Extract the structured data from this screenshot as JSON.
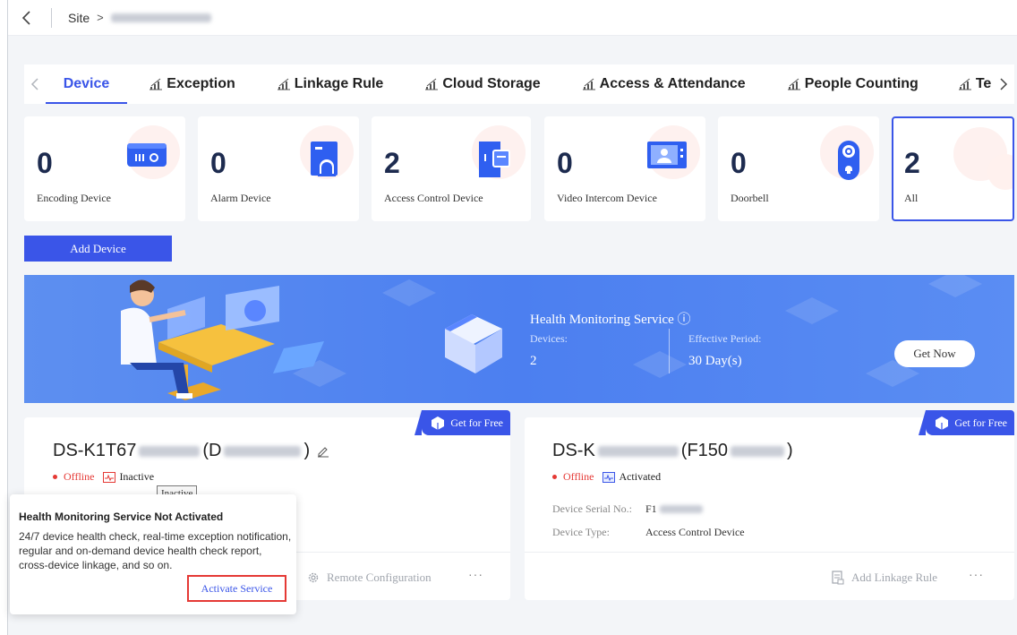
{
  "breadcrumb": {
    "site_label": "Site",
    "separator": ">"
  },
  "tabs": [
    {
      "label": "Device",
      "active": true
    },
    {
      "label": "Exception"
    },
    {
      "label": "Linkage Rule"
    },
    {
      "label": "Cloud Storage"
    },
    {
      "label": "Access & Attendance"
    },
    {
      "label": "People Counting"
    },
    {
      "label": "Te"
    }
  ],
  "stats": [
    {
      "count": "0",
      "label": "Encoding Device",
      "icon": "nvr-icon"
    },
    {
      "count": "0",
      "label": "Alarm Device",
      "icon": "alarm-panel-icon"
    },
    {
      "count": "2",
      "label": "Access Control Device",
      "icon": "door-access-icon"
    },
    {
      "count": "0",
      "label": "Video Intercom Device",
      "icon": "intercom-icon"
    },
    {
      "count": "0",
      "label": "Doorbell",
      "icon": "doorbell-icon"
    },
    {
      "count": "2",
      "label": "All",
      "selected": true
    }
  ],
  "add_device_label": "Add Device",
  "banner": {
    "title": "Health Monitoring Service ⓘ",
    "devices_label": "Devices:",
    "devices_value": "2",
    "period_label": "Effective Period:",
    "period_value": "30 Day(s)",
    "cta": "Get Now"
  },
  "devices": [
    {
      "name_prefix": "DS-K1T67",
      "name_mid": "(D",
      "name_suffix": ")",
      "status": "Offline",
      "activation": "Inactive",
      "badge": "Get for Free",
      "footer_action": "Remote Configuration",
      "more": "···"
    },
    {
      "name_prefix": "DS-K",
      "name_mid": "(F150",
      "name_suffix": ")",
      "status": "Offline",
      "activation": "Activated",
      "serial_label": "Device Serial No.:",
      "serial_prefix": "F1",
      "type_label": "Device Type:",
      "type_value": "Access Control Device",
      "badge": "Get for Free",
      "footer_action": "Add Linkage Rule",
      "more": "···"
    }
  ],
  "tooltip": "Inactive",
  "popover": {
    "title": "Health Monitoring Service Not Activated",
    "body": "24/7 device health check, real-time exception notification, regular and on-demand device health check report, cross-device linkage, and so on.",
    "action": "Activate Service"
  },
  "colors": {
    "accent": "#3a55e8",
    "offline": "#e53935",
    "banner": "#4c7ff0"
  }
}
